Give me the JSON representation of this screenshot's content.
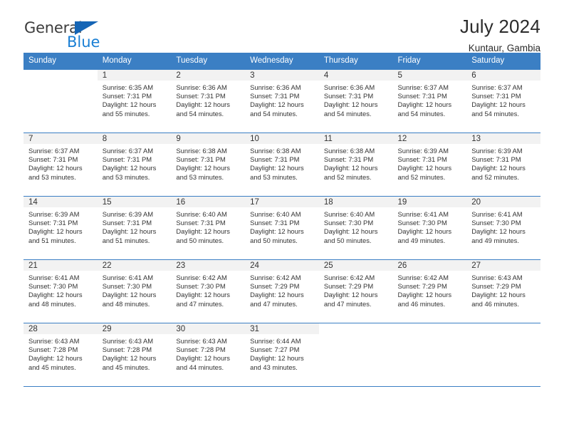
{
  "brand": {
    "name_top": "General",
    "name_bottom": "Blue",
    "accent_color": "#1a7fd4",
    "triangle_color": "#1565b5"
  },
  "header": {
    "title": "July 2024",
    "location": "Kuntaur, Gambia",
    "header_bg": "#3b7fc4",
    "header_text_color": "#ffffff",
    "daynum_bg": "#f2f2f2"
  },
  "weekday_headers": [
    "Sunday",
    "Monday",
    "Tuesday",
    "Wednesday",
    "Thursday",
    "Friday",
    "Saturday"
  ],
  "weeks": [
    [
      {
        "day": "",
        "sunrise": "",
        "sunset": "",
        "daylight_line1": "",
        "daylight_line2": ""
      },
      {
        "day": "1",
        "sunrise": "Sunrise: 6:35 AM",
        "sunset": "Sunset: 7:31 PM",
        "daylight_line1": "Daylight: 12 hours",
        "daylight_line2": "and 55 minutes."
      },
      {
        "day": "2",
        "sunrise": "Sunrise: 6:36 AM",
        "sunset": "Sunset: 7:31 PM",
        "daylight_line1": "Daylight: 12 hours",
        "daylight_line2": "and 54 minutes."
      },
      {
        "day": "3",
        "sunrise": "Sunrise: 6:36 AM",
        "sunset": "Sunset: 7:31 PM",
        "daylight_line1": "Daylight: 12 hours",
        "daylight_line2": "and 54 minutes."
      },
      {
        "day": "4",
        "sunrise": "Sunrise: 6:36 AM",
        "sunset": "Sunset: 7:31 PM",
        "daylight_line1": "Daylight: 12 hours",
        "daylight_line2": "and 54 minutes."
      },
      {
        "day": "5",
        "sunrise": "Sunrise: 6:37 AM",
        "sunset": "Sunset: 7:31 PM",
        "daylight_line1": "Daylight: 12 hours",
        "daylight_line2": "and 54 minutes."
      },
      {
        "day": "6",
        "sunrise": "Sunrise: 6:37 AM",
        "sunset": "Sunset: 7:31 PM",
        "daylight_line1": "Daylight: 12 hours",
        "daylight_line2": "and 54 minutes."
      }
    ],
    [
      {
        "day": "7",
        "sunrise": "Sunrise: 6:37 AM",
        "sunset": "Sunset: 7:31 PM",
        "daylight_line1": "Daylight: 12 hours",
        "daylight_line2": "and 53 minutes."
      },
      {
        "day": "8",
        "sunrise": "Sunrise: 6:37 AM",
        "sunset": "Sunset: 7:31 PM",
        "daylight_line1": "Daylight: 12 hours",
        "daylight_line2": "and 53 minutes."
      },
      {
        "day": "9",
        "sunrise": "Sunrise: 6:38 AM",
        "sunset": "Sunset: 7:31 PM",
        "daylight_line1": "Daylight: 12 hours",
        "daylight_line2": "and 53 minutes."
      },
      {
        "day": "10",
        "sunrise": "Sunrise: 6:38 AM",
        "sunset": "Sunset: 7:31 PM",
        "daylight_line1": "Daylight: 12 hours",
        "daylight_line2": "and 53 minutes."
      },
      {
        "day": "11",
        "sunrise": "Sunrise: 6:38 AM",
        "sunset": "Sunset: 7:31 PM",
        "daylight_line1": "Daylight: 12 hours",
        "daylight_line2": "and 52 minutes."
      },
      {
        "day": "12",
        "sunrise": "Sunrise: 6:39 AM",
        "sunset": "Sunset: 7:31 PM",
        "daylight_line1": "Daylight: 12 hours",
        "daylight_line2": "and 52 minutes."
      },
      {
        "day": "13",
        "sunrise": "Sunrise: 6:39 AM",
        "sunset": "Sunset: 7:31 PM",
        "daylight_line1": "Daylight: 12 hours",
        "daylight_line2": "and 52 minutes."
      }
    ],
    [
      {
        "day": "14",
        "sunrise": "Sunrise: 6:39 AM",
        "sunset": "Sunset: 7:31 PM",
        "daylight_line1": "Daylight: 12 hours",
        "daylight_line2": "and 51 minutes."
      },
      {
        "day": "15",
        "sunrise": "Sunrise: 6:39 AM",
        "sunset": "Sunset: 7:31 PM",
        "daylight_line1": "Daylight: 12 hours",
        "daylight_line2": "and 51 minutes."
      },
      {
        "day": "16",
        "sunrise": "Sunrise: 6:40 AM",
        "sunset": "Sunset: 7:31 PM",
        "daylight_line1": "Daylight: 12 hours",
        "daylight_line2": "and 50 minutes."
      },
      {
        "day": "17",
        "sunrise": "Sunrise: 6:40 AM",
        "sunset": "Sunset: 7:31 PM",
        "daylight_line1": "Daylight: 12 hours",
        "daylight_line2": "and 50 minutes."
      },
      {
        "day": "18",
        "sunrise": "Sunrise: 6:40 AM",
        "sunset": "Sunset: 7:30 PM",
        "daylight_line1": "Daylight: 12 hours",
        "daylight_line2": "and 50 minutes."
      },
      {
        "day": "19",
        "sunrise": "Sunrise: 6:41 AM",
        "sunset": "Sunset: 7:30 PM",
        "daylight_line1": "Daylight: 12 hours",
        "daylight_line2": "and 49 minutes."
      },
      {
        "day": "20",
        "sunrise": "Sunrise: 6:41 AM",
        "sunset": "Sunset: 7:30 PM",
        "daylight_line1": "Daylight: 12 hours",
        "daylight_line2": "and 49 minutes."
      }
    ],
    [
      {
        "day": "21",
        "sunrise": "Sunrise: 6:41 AM",
        "sunset": "Sunset: 7:30 PM",
        "daylight_line1": "Daylight: 12 hours",
        "daylight_line2": "and 48 minutes."
      },
      {
        "day": "22",
        "sunrise": "Sunrise: 6:41 AM",
        "sunset": "Sunset: 7:30 PM",
        "daylight_line1": "Daylight: 12 hours",
        "daylight_line2": "and 48 minutes."
      },
      {
        "day": "23",
        "sunrise": "Sunrise: 6:42 AM",
        "sunset": "Sunset: 7:30 PM",
        "daylight_line1": "Daylight: 12 hours",
        "daylight_line2": "and 47 minutes."
      },
      {
        "day": "24",
        "sunrise": "Sunrise: 6:42 AM",
        "sunset": "Sunset: 7:29 PM",
        "daylight_line1": "Daylight: 12 hours",
        "daylight_line2": "and 47 minutes."
      },
      {
        "day": "25",
        "sunrise": "Sunrise: 6:42 AM",
        "sunset": "Sunset: 7:29 PM",
        "daylight_line1": "Daylight: 12 hours",
        "daylight_line2": "and 47 minutes."
      },
      {
        "day": "26",
        "sunrise": "Sunrise: 6:42 AM",
        "sunset": "Sunset: 7:29 PM",
        "daylight_line1": "Daylight: 12 hours",
        "daylight_line2": "and 46 minutes."
      },
      {
        "day": "27",
        "sunrise": "Sunrise: 6:43 AM",
        "sunset": "Sunset: 7:29 PM",
        "daylight_line1": "Daylight: 12 hours",
        "daylight_line2": "and 46 minutes."
      }
    ],
    [
      {
        "day": "28",
        "sunrise": "Sunrise: 6:43 AM",
        "sunset": "Sunset: 7:28 PM",
        "daylight_line1": "Daylight: 12 hours",
        "daylight_line2": "and 45 minutes."
      },
      {
        "day": "29",
        "sunrise": "Sunrise: 6:43 AM",
        "sunset": "Sunset: 7:28 PM",
        "daylight_line1": "Daylight: 12 hours",
        "daylight_line2": "and 45 minutes."
      },
      {
        "day": "30",
        "sunrise": "Sunrise: 6:43 AM",
        "sunset": "Sunset: 7:28 PM",
        "daylight_line1": "Daylight: 12 hours",
        "daylight_line2": "and 44 minutes."
      },
      {
        "day": "31",
        "sunrise": "Sunrise: 6:44 AM",
        "sunset": "Sunset: 7:27 PM",
        "daylight_line1": "Daylight: 12 hours",
        "daylight_line2": "and 43 minutes."
      },
      {
        "day": "",
        "sunrise": "",
        "sunset": "",
        "daylight_line1": "",
        "daylight_line2": ""
      },
      {
        "day": "",
        "sunrise": "",
        "sunset": "",
        "daylight_line1": "",
        "daylight_line2": ""
      },
      {
        "day": "",
        "sunrise": "",
        "sunset": "",
        "daylight_line1": "",
        "daylight_line2": ""
      }
    ]
  ]
}
